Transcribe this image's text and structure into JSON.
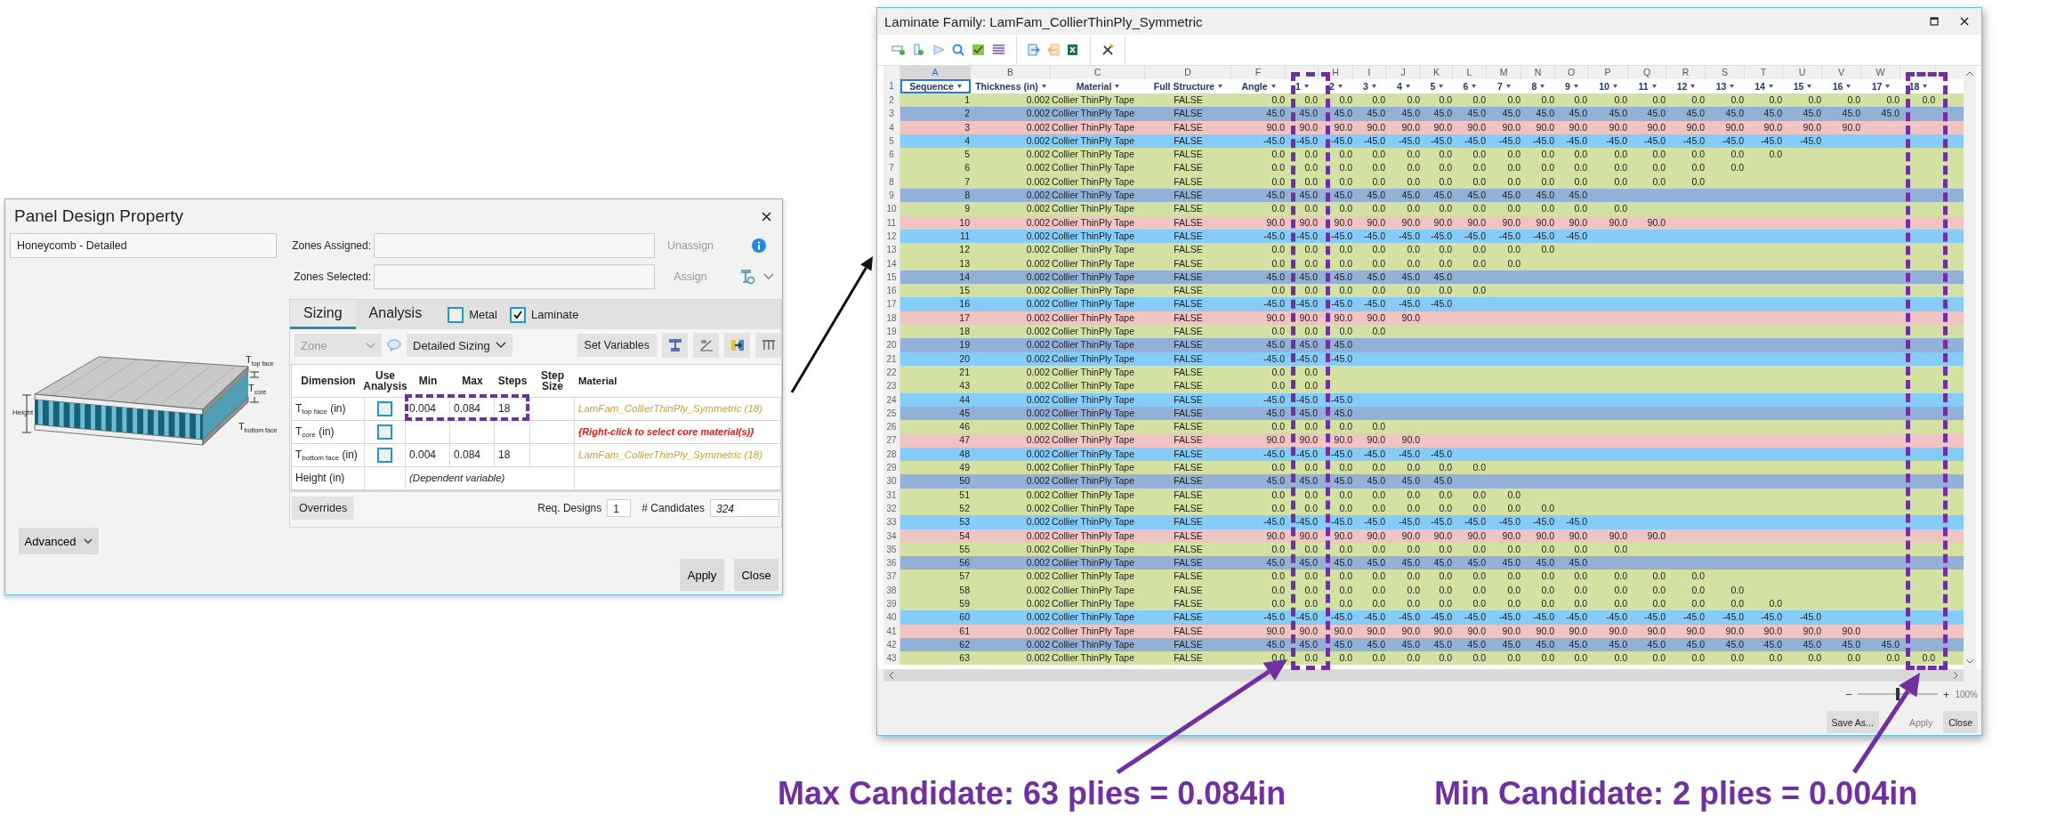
{
  "dialog": {
    "title": "Panel Design Property",
    "name_field": "Honeycomb - Detailed",
    "zones": [
      {
        "label": "Zones Assigned:",
        "action": "Unassign"
      },
      {
        "label": "Zones Selected:",
        "action": "Assign"
      }
    ],
    "tabs": [
      {
        "label": "Sizing",
        "selected": true
      },
      {
        "label": "Analysis",
        "selected": false
      }
    ],
    "checkboxes": [
      {
        "label": "Metal",
        "checked": false
      },
      {
        "label": "Laminate",
        "checked": true
      }
    ],
    "zone_dropdown": {
      "value": "Zone",
      "disabled": true
    },
    "sizing_dropdown": "Detailed Sizing",
    "set_variables": "Set Variables",
    "columns": [
      "Dimension",
      "Use Analysis",
      "Min",
      "Max",
      "Steps",
      "Step Size",
      "Material"
    ],
    "rows": [
      {
        "dimension": "T$_{top face}$ (in)",
        "use_analysis": false,
        "min": "0.004",
        "max": "0.084",
        "steps": "18",
        "material": "LamFam_CollierThinPly_Symmetric (18)",
        "kind": "assigned"
      },
      {
        "dimension": "T$_{core}$ (in)",
        "use_analysis": false,
        "material": "{Right-click to select core material(s)}",
        "kind": "prompt"
      },
      {
        "dimension": "T$_{bottom face}$ (in)",
        "use_analysis": false,
        "min": "0.004",
        "max": "0.084",
        "steps": "18",
        "material": "LamFam_CollierThinPly_Symmetric (18)",
        "kind": "assigned"
      },
      {
        "dimension": "Height (in)",
        "note": "(Dependent variable)",
        "kind": "dependent"
      }
    ],
    "overrides": "Overrides",
    "req_designs_label": "Req. Designs",
    "req_designs": "1",
    "candidates_label": "# Candidates",
    "candidates": "324",
    "advanced": "Advanced",
    "buttons": [
      "Apply",
      "Close"
    ],
    "figure_labels": {
      "top_face": "T$_{top face}$",
      "core": "T$_{core}$",
      "bottom_face": "T$_{bottom face}$",
      "height": "Height"
    }
  },
  "laminate": {
    "title": "Laminate Family: LamFam_CollierThinPly_Symmetric",
    "header_row_number": "1",
    "columns": [
      {
        "letter": "A",
        "header": "Sequence",
        "selected": true
      },
      {
        "letter": "B",
        "header": "Thickness (in)",
        "selected": false
      },
      {
        "letter": "C",
        "header": "Material",
        "selected": false
      },
      {
        "letter": "D",
        "header": "Full Structure",
        "selected": false
      },
      {
        "letter": "F",
        "header": "Angle",
        "selected": false
      },
      {
        "header": "1",
        "selected": false
      },
      {
        "letter": "H",
        "header": "2",
        "selected": false
      },
      {
        "letter": "I",
        "header": "3",
        "selected": false
      },
      {
        "letter": "J",
        "header": "4",
        "selected": false
      },
      {
        "letter": "K",
        "header": "5",
        "selected": false
      },
      {
        "letter": "L",
        "header": "6",
        "selected": false
      },
      {
        "letter": "M",
        "header": "7",
        "selected": false
      },
      {
        "letter": "N",
        "header": "8",
        "selected": false
      },
      {
        "letter": "O",
        "header": "9",
        "selected": false
      },
      {
        "letter": "P",
        "header": "10",
        "selected": false
      },
      {
        "letter": "Q",
        "header": "11",
        "selected": false
      },
      {
        "letter": "R",
        "header": "12",
        "selected": false
      },
      {
        "letter": "S",
        "header": "13",
        "selected": false
      },
      {
        "letter": "T",
        "header": "14",
        "selected": false
      },
      {
        "letter": "U",
        "header": "15",
        "selected": false
      },
      {
        "letter": "V",
        "header": "16",
        "selected": false
      },
      {
        "letter": "W",
        "header": "17",
        "selected": false
      },
      {
        "header": "18",
        "selected": false
      }
    ],
    "rows": [
      {
        "row": "2",
        "sequence": "1",
        "thickness": "0.002",
        "material": "Collier ThinPly Tape",
        "full_structure": "FALSE",
        "angle": "0.0",
        "color": "#d3e2a3",
        "plies": [
          "0.0",
          "0.0",
          "0.0",
          "0.0",
          "0.0",
          "0.0",
          "0.0",
          "0.0",
          "0.0",
          "0.0",
          "0.0",
          "0.0",
          "0.0",
          "0.0",
          "0.0",
          "0.0",
          "0.0",
          "0.0"
        ]
      },
      {
        "row": "3",
        "sequence": "2",
        "thickness": "0.002",
        "material": "Collier ThinPly Tape",
        "full_structure": "FALSE",
        "angle": "45.0",
        "color": "#93b1d7",
        "plies": [
          "45.0",
          "45.0",
          "45.0",
          "45.0",
          "45.0",
          "45.0",
          "45.0",
          "45.0",
          "45.0",
          "45.0",
          "45.0",
          "45.0",
          "45.0",
          "45.0",
          "45.0",
          "45.0",
          "45.0"
        ]
      },
      {
        "row": "4",
        "sequence": "3",
        "thickness": "0.002",
        "material": "Collier ThinPly Tape",
        "full_structure": "FALSE",
        "angle": "90.0",
        "color": "#f1c4c4",
        "plies": [
          "90.0",
          "90.0",
          "90.0",
          "90.0",
          "90.0",
          "90.0",
          "90.0",
          "90.0",
          "90.0",
          "90.0",
          "90.0",
          "90.0",
          "90.0",
          "90.0",
          "90.0",
          "90.0"
        ]
      },
      {
        "row": "5",
        "sequence": "4",
        "thickness": "0.002",
        "material": "Collier ThinPly Tape",
        "full_structure": "FALSE",
        "angle": "-45.0",
        "color": "#86ccf8",
        "plies": [
          "-45.0",
          "-45.0",
          "-45.0",
          "-45.0",
          "-45.0",
          "-45.0",
          "-45.0",
          "-45.0",
          "-45.0",
          "-45.0",
          "-45.0",
          "-45.0",
          "-45.0",
          "-45.0",
          "-45.0"
        ]
      },
      {
        "row": "6",
        "sequence": "5",
        "thickness": "0.002",
        "material": "Collier ThinPly Tape",
        "full_structure": "FALSE",
        "angle": "0.0",
        "color": "#d3e2a3",
        "plies": [
          "0.0",
          "0.0",
          "0.0",
          "0.0",
          "0.0",
          "0.0",
          "0.0",
          "0.0",
          "0.0",
          "0.0",
          "0.0",
          "0.0",
          "0.0",
          "0.0"
        ]
      },
      {
        "row": "7",
        "sequence": "6",
        "thickness": "0.002",
        "material": "Collier ThinPly Tape",
        "full_structure": "FALSE",
        "angle": "0.0",
        "color": "#d3e2a3",
        "plies": [
          "0.0",
          "0.0",
          "0.0",
          "0.0",
          "0.0",
          "0.0",
          "0.0",
          "0.0",
          "0.0",
          "0.0",
          "0.0",
          "0.0",
          "0.0"
        ]
      },
      {
        "row": "8",
        "sequence": "7",
        "thickness": "0.002",
        "material": "Collier ThinPly Tape",
        "full_structure": "FALSE",
        "angle": "0.0",
        "color": "#d3e2a3",
        "plies": [
          "0.0",
          "0.0",
          "0.0",
          "0.0",
          "0.0",
          "0.0",
          "0.0",
          "0.0",
          "0.0",
          "0.0",
          "0.0",
          "0.0"
        ]
      },
      {
        "row": "9",
        "sequence": "8",
        "thickness": "0.002",
        "material": "Collier ThinPly Tape",
        "full_structure": "FALSE",
        "angle": "45.0",
        "color": "#93b1d7",
        "plies": [
          "45.0",
          "45.0",
          "45.0",
          "45.0",
          "45.0",
          "45.0",
          "45.0",
          "45.0",
          "45.0"
        ]
      },
      {
        "row": "10",
        "sequence": "9",
        "thickness": "0.002",
        "material": "Collier ThinPly Tape",
        "full_structure": "FALSE",
        "angle": "0.0",
        "color": "#d3e2a3",
        "plies": [
          "0.0",
          "0.0",
          "0.0",
          "0.0",
          "0.0",
          "0.0",
          "0.0",
          "0.0",
          "0.0",
          "0.0"
        ]
      },
      {
        "row": "11",
        "sequence": "10",
        "thickness": "0.002",
        "material": "Collier ThinPly Tape",
        "full_structure": "FALSE",
        "angle": "90.0",
        "color": "#f1c4c4",
        "plies": [
          "90.0",
          "90.0",
          "90.0",
          "90.0",
          "90.0",
          "90.0",
          "90.0",
          "90.0",
          "90.0",
          "90.0",
          "90.0"
        ]
      },
      {
        "row": "12",
        "sequence": "11",
        "thickness": "0.002",
        "material": "Collier ThinPly Tape",
        "full_structure": "FALSE",
        "angle": "-45.0",
        "color": "#86ccf8",
        "plies": [
          "-45.0",
          "-45.0",
          "-45.0",
          "-45.0",
          "-45.0",
          "-45.0",
          "-45.0",
          "-45.0",
          "-45.0"
        ]
      },
      {
        "row": "13",
        "sequence": "12",
        "thickness": "0.002",
        "material": "Collier ThinPly Tape",
        "full_structure": "FALSE",
        "angle": "0.0",
        "color": "#d3e2a3",
        "plies": [
          "0.0",
          "0.0",
          "0.0",
          "0.0",
          "0.0",
          "0.0",
          "0.0",
          "0.0"
        ]
      },
      {
        "row": "14",
        "sequence": "13",
        "thickness": "0.002",
        "material": "Collier ThinPly Tape",
        "full_structure": "FALSE",
        "angle": "0.0",
        "color": "#d3e2a3",
        "plies": [
          "0.0",
          "0.0",
          "0.0",
          "0.0",
          "0.0",
          "0.0",
          "0.0"
        ]
      },
      {
        "row": "15",
        "sequence": "14",
        "thickness": "0.002",
        "material": "Collier ThinPly Tape",
        "full_structure": "FALSE",
        "angle": "45.0",
        "color": "#93b1d7",
        "plies": [
          "45.0",
          "45.0",
          "45.0",
          "45.0",
          "45.0"
        ]
      },
      {
        "row": "16",
        "sequence": "15",
        "thickness": "0.002",
        "material": "Collier ThinPly Tape",
        "full_structure": "FALSE",
        "angle": "0.0",
        "color": "#d3e2a3",
        "plies": [
          "0.0",
          "0.0",
          "0.0",
          "0.0",
          "0.0",
          "0.0"
        ]
      },
      {
        "row": "17",
        "sequence": "16",
        "thickness": "0.002",
        "material": "Collier ThinPly Tape",
        "full_structure": "FALSE",
        "angle": "-45.0",
        "color": "#86ccf8",
        "plies": [
          "-45.0",
          "-45.0",
          "-45.0",
          "-45.0",
          "-45.0"
        ]
      },
      {
        "row": "18",
        "sequence": "17",
        "thickness": "0.002",
        "material": "Collier ThinPly Tape",
        "full_structure": "FALSE",
        "angle": "90.0",
        "color": "#f1c4c4",
        "plies": [
          "90.0",
          "90.0",
          "90.0",
          "90.0"
        ]
      },
      {
        "row": "19",
        "sequence": "18",
        "thickness": "0.002",
        "material": "Collier ThinPly Tape",
        "full_structure": "FALSE",
        "angle": "0.0",
        "color": "#d3e2a3",
        "plies": [
          "0.0",
          "0.0",
          "0.0"
        ]
      },
      {
        "row": "20",
        "sequence": "19",
        "thickness": "0.002",
        "material": "Collier ThinPly Tape",
        "full_structure": "FALSE",
        "angle": "45.0",
        "color": "#93b1d7",
        "plies": [
          "45.0",
          "45.0"
        ]
      },
      {
        "row": "21",
        "sequence": "20",
        "thickness": "0.002",
        "material": "Collier ThinPly Tape",
        "full_structure": "FALSE",
        "angle": "-45.0",
        "color": "#86ccf8",
        "plies": [
          "-45.0",
          "-45.0"
        ]
      },
      {
        "row": "22",
        "sequence": "21",
        "thickness": "0.002",
        "material": "Collier ThinPly Tape",
        "full_structure": "FALSE",
        "angle": "0.0",
        "color": "#d3e2a3",
        "plies": [
          "0.0"
        ]
      },
      {
        "row": "23",
        "sequence": "43",
        "thickness": "0.002",
        "material": "Collier ThinPly Tape",
        "full_structure": "FALSE",
        "angle": "0.0",
        "color": "#d3e2a3",
        "plies": [
          "0.0"
        ]
      },
      {
        "row": "24",
        "sequence": "44",
        "thickness": "0.002",
        "material": "Collier ThinPly Tape",
        "full_structure": "FALSE",
        "angle": "-45.0",
        "color": "#86ccf8",
        "plies": [
          "-45.0",
          "-45.0"
        ]
      },
      {
        "row": "25",
        "sequence": "45",
        "thickness": "0.002",
        "material": "Collier ThinPly Tape",
        "full_structure": "FALSE",
        "angle": "45.0",
        "color": "#93b1d7",
        "plies": [
          "45.0",
          "45.0"
        ]
      },
      {
        "row": "26",
        "sequence": "46",
        "thickness": "0.002",
        "material": "Collier ThinPly Tape",
        "full_structure": "FALSE",
        "angle": "0.0",
        "color": "#d3e2a3",
        "plies": [
          "0.0",
          "0.0",
          "0.0"
        ]
      },
      {
        "row": "27",
        "sequence": "47",
        "thickness": "0.002",
        "material": "Collier ThinPly Tape",
        "full_structure": "FALSE",
        "angle": "90.0",
        "color": "#f1c4c4",
        "plies": [
          "90.0",
          "90.0",
          "90.0",
          "90.0"
        ]
      },
      {
        "row": "28",
        "sequence": "48",
        "thickness": "0.002",
        "material": "Collier ThinPly Tape",
        "full_structure": "FALSE",
        "angle": "-45.0",
        "color": "#86ccf8",
        "plies": [
          "-45.0",
          "-45.0",
          "-45.0",
          "-45.0",
          "-45.0"
        ]
      },
      {
        "row": "29",
        "sequence": "49",
        "thickness": "0.002",
        "material": "Collier ThinPly Tape",
        "full_structure": "FALSE",
        "angle": "0.0",
        "color": "#d3e2a3",
        "plies": [
          "0.0",
          "0.0",
          "0.0",
          "0.0",
          "0.0",
          "0.0"
        ]
      },
      {
        "row": "30",
        "sequence": "50",
        "thickness": "0.002",
        "material": "Collier ThinPly Tape",
        "full_structure": "FALSE",
        "angle": "45.0",
        "color": "#93b1d7",
        "plies": [
          "45.0",
          "45.0",
          "45.0",
          "45.0",
          "45.0"
        ]
      },
      {
        "row": "31",
        "sequence": "51",
        "thickness": "0.002",
        "material": "Collier ThinPly Tape",
        "full_structure": "FALSE",
        "angle": "0.0",
        "color": "#d3e2a3",
        "plies": [
          "0.0",
          "0.0",
          "0.0",
          "0.0",
          "0.0",
          "0.0",
          "0.0"
        ]
      },
      {
        "row": "32",
        "sequence": "52",
        "thickness": "0.002",
        "material": "Collier ThinPly Tape",
        "full_structure": "FALSE",
        "angle": "0.0",
        "color": "#d3e2a3",
        "plies": [
          "0.0",
          "0.0",
          "0.0",
          "0.0",
          "0.0",
          "0.0",
          "0.0",
          "0.0"
        ]
      },
      {
        "row": "33",
        "sequence": "53",
        "thickness": "0.002",
        "material": "Collier ThinPly Tape",
        "full_structure": "FALSE",
        "angle": "-45.0",
        "color": "#86ccf8",
        "plies": [
          "-45.0",
          "-45.0",
          "-45.0",
          "-45.0",
          "-45.0",
          "-45.0",
          "-45.0",
          "-45.0",
          "-45.0"
        ]
      },
      {
        "row": "34",
        "sequence": "54",
        "thickness": "0.002",
        "material": "Collier ThinPly Tape",
        "full_structure": "FALSE",
        "angle": "90.0",
        "color": "#f1c4c4",
        "plies": [
          "90.0",
          "90.0",
          "90.0",
          "90.0",
          "90.0",
          "90.0",
          "90.0",
          "90.0",
          "90.0",
          "90.0",
          "90.0"
        ]
      },
      {
        "row": "35",
        "sequence": "55",
        "thickness": "0.002",
        "material": "Collier ThinPly Tape",
        "full_structure": "FALSE",
        "angle": "0.0",
        "color": "#d3e2a3",
        "plies": [
          "0.0",
          "0.0",
          "0.0",
          "0.0",
          "0.0",
          "0.0",
          "0.0",
          "0.0",
          "0.0",
          "0.0"
        ]
      },
      {
        "row": "36",
        "sequence": "56",
        "thickness": "0.002",
        "material": "Collier ThinPly Tape",
        "full_structure": "FALSE",
        "angle": "45.0",
        "color": "#93b1d7",
        "plies": [
          "45.0",
          "45.0",
          "45.0",
          "45.0",
          "45.0",
          "45.0",
          "45.0",
          "45.0",
          "45.0"
        ]
      },
      {
        "row": "37",
        "sequence": "57",
        "thickness": "0.002",
        "material": "Collier ThinPly Tape",
        "full_structure": "FALSE",
        "angle": "0.0",
        "color": "#d3e2a3",
        "plies": [
          "0.0",
          "0.0",
          "0.0",
          "0.0",
          "0.0",
          "0.0",
          "0.0",
          "0.0",
          "0.0",
          "0.0",
          "0.0",
          "0.0"
        ]
      },
      {
        "row": "38",
        "sequence": "58",
        "thickness": "0.002",
        "material": "Collier ThinPly Tape",
        "full_structure": "FALSE",
        "angle": "0.0",
        "color": "#d3e2a3",
        "plies": [
          "0.0",
          "0.0",
          "0.0",
          "0.0",
          "0.0",
          "0.0",
          "0.0",
          "0.0",
          "0.0",
          "0.0",
          "0.0",
          "0.0",
          "0.0"
        ]
      },
      {
        "row": "39",
        "sequence": "59",
        "thickness": "0.002",
        "material": "Collier ThinPly Tape",
        "full_structure": "FALSE",
        "angle": "0.0",
        "color": "#d3e2a3",
        "plies": [
          "0.0",
          "0.0",
          "0.0",
          "0.0",
          "0.0",
          "0.0",
          "0.0",
          "0.0",
          "0.0",
          "0.0",
          "0.0",
          "0.0",
          "0.0",
          "0.0"
        ]
      },
      {
        "row": "40",
        "sequence": "60",
        "thickness": "0.002",
        "material": "Collier ThinPly Tape",
        "full_structure": "FALSE",
        "angle": "-45.0",
        "color": "#86ccf8",
        "plies": [
          "-45.0",
          "-45.0",
          "-45.0",
          "-45.0",
          "-45.0",
          "-45.0",
          "-45.0",
          "-45.0",
          "-45.0",
          "-45.0",
          "-45.0",
          "-45.0",
          "-45.0",
          "-45.0",
          "-45.0"
        ]
      },
      {
        "row": "41",
        "sequence": "61",
        "thickness": "0.002",
        "material": "Collier ThinPly Tape",
        "full_structure": "FALSE",
        "angle": "90.0",
        "color": "#f1c4c4",
        "plies": [
          "90.0",
          "90.0",
          "90.0",
          "90.0",
          "90.0",
          "90.0",
          "90.0",
          "90.0",
          "90.0",
          "90.0",
          "90.0",
          "90.0",
          "90.0",
          "90.0",
          "90.0",
          "90.0"
        ]
      },
      {
        "row": "42",
        "sequence": "62",
        "thickness": "0.002",
        "material": "Collier ThinPly Tape",
        "full_structure": "FALSE",
        "angle": "45.0",
        "color": "#93b1d7",
        "plies": [
          "45.0",
          "45.0",
          "45.0",
          "45.0",
          "45.0",
          "45.0",
          "45.0",
          "45.0",
          "45.0",
          "45.0",
          "45.0",
          "45.0",
          "45.0",
          "45.0",
          "45.0",
          "45.0",
          "45.0"
        ]
      },
      {
        "row": "43",
        "sequence": "63",
        "thickness": "0.002",
        "material": "Collier ThinPly Tape",
        "full_structure": "FALSE",
        "angle": "0.0",
        "color": "#d3e2a3",
        "plies": [
          "0.0",
          "0.0",
          "0.0",
          "0.0",
          "0.0",
          "0.0",
          "0.0",
          "0.0",
          "0.0",
          "0.0",
          "0.0",
          "0.0",
          "0.0",
          "0.0",
          "0.0",
          "0.0",
          "0.0",
          "0.0"
        ]
      }
    ],
    "zoom": {
      "zoom_out": "−",
      "zoom_in": "+",
      "level": 0.5,
      "reading": "100%"
    },
    "buttons": [
      {
        "label": "Save As...",
        "disabled": false
      },
      {
        "label": "Apply",
        "disabled": true
      },
      {
        "label": "Close",
        "disabled": false
      }
    ]
  },
  "annotations": [
    "Max Candidate: 63 plies = 0.084in",
    "Min Candidate: 2 plies = 0.004in"
  ]
}
